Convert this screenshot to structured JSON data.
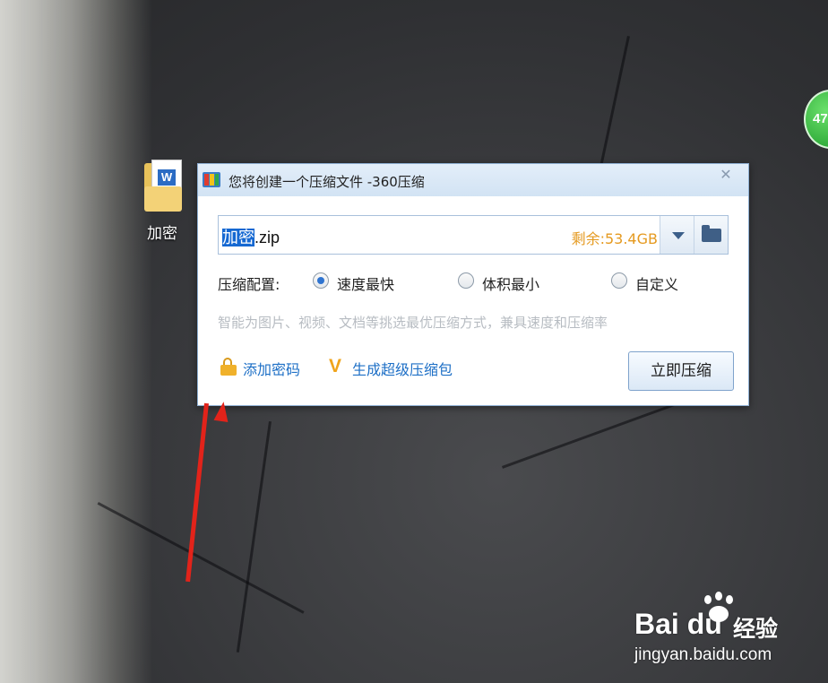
{
  "desktop": {
    "file_icon_label": "加密",
    "badge_text": "47"
  },
  "dialog": {
    "title": "您将创建一个压缩文件 -360压缩",
    "close_glyph": "✕",
    "filename_selected": "加密",
    "filename_ext": ".zip",
    "remaining_space": "剩余:53.4GB",
    "config_label": "压缩配置:",
    "options": [
      {
        "label": "速度最快",
        "selected": true
      },
      {
        "label": "体积最小",
        "selected": false
      },
      {
        "label": "自定义",
        "selected": false
      }
    ],
    "hint": "智能为图片、视频、文档等挑选最优压缩方式，兼具速度和压缩率",
    "add_password_label": "添加密码",
    "super_package_label": "生成超级压缩包",
    "super_icon_glyph": "V",
    "compress_button_label": "立即压缩"
  },
  "colors": {
    "accent_blue": "#1d6fc6",
    "remain_orange": "#e59a20",
    "arrow_red": "#e2231a"
  },
  "watermark": {
    "brand": "Bai  du",
    "cn": "经验",
    "url": "jingyan.baidu.com"
  }
}
